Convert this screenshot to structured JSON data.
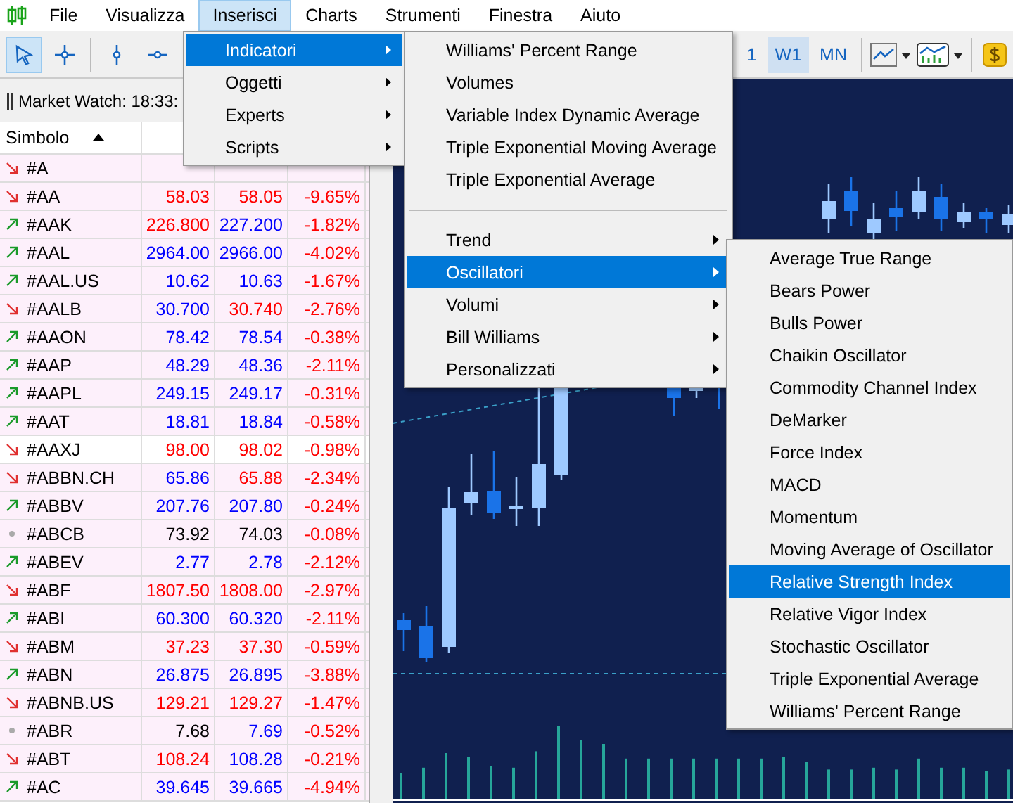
{
  "menubar": [
    {
      "label": "File",
      "selected": false
    },
    {
      "label": "Visualizza",
      "selected": false
    },
    {
      "label": "Inserisci",
      "selected": true
    },
    {
      "label": "Charts",
      "selected": false
    },
    {
      "label": "Strumenti",
      "selected": false
    },
    {
      "label": "Finestra",
      "selected": false
    },
    {
      "label": "Aiuto",
      "selected": false
    }
  ],
  "toolbar": {
    "timeframes": [
      {
        "label": "1",
        "selected": false
      },
      {
        "label": "W1",
        "selected": true
      },
      {
        "label": "MN",
        "selected": false
      }
    ]
  },
  "market_watch": {
    "title": "Market Watch: 18:33:",
    "columns": [
      "Simbolo"
    ],
    "rows": [
      {
        "symbol": "#A",
        "kind": "down",
        "shaded": true
      },
      {
        "symbol": "#AA",
        "kind": "down",
        "bid": {
          "text": "58.03",
          "color": "#ff0000"
        },
        "ask": {
          "text": "58.05",
          "color": "#ff0000"
        },
        "change": "-9.65%",
        "shaded": true
      },
      {
        "symbol": "#AAK",
        "kind": "up",
        "bid": {
          "text": "226.800",
          "color": "#ff0000"
        },
        "ask": {
          "text": "227.200",
          "color": "#0000ff"
        },
        "change": "-1.82%",
        "shaded": true
      },
      {
        "symbol": "#AAL",
        "kind": "up",
        "bid": {
          "text": "2964.00",
          "color": "#0000ff"
        },
        "ask": {
          "text": "2966.00",
          "color": "#0000ff"
        },
        "change": "-4.02%",
        "shaded": true
      },
      {
        "symbol": "#AAL.US",
        "kind": "up",
        "bid": {
          "text": "10.62",
          "color": "#0000ff"
        },
        "ask": {
          "text": "10.63",
          "color": "#0000ff"
        },
        "change": "-1.67%",
        "shaded": true
      },
      {
        "symbol": "#AALB",
        "kind": "down",
        "bid": {
          "text": "30.700",
          "color": "#0000ff"
        },
        "ask": {
          "text": "30.740",
          "color": "#ff0000"
        },
        "change": "-2.76%",
        "shaded": true
      },
      {
        "symbol": "#AAON",
        "kind": "up",
        "bid": {
          "text": "78.42",
          "color": "#0000ff"
        },
        "ask": {
          "text": "78.54",
          "color": "#0000ff"
        },
        "change": "-0.38%",
        "shaded": true
      },
      {
        "symbol": "#AAP",
        "kind": "up",
        "bid": {
          "text": "48.29",
          "color": "#0000ff"
        },
        "ask": {
          "text": "48.36",
          "color": "#0000ff"
        },
        "change": "-2.11%",
        "shaded": true
      },
      {
        "symbol": "#AAPL",
        "kind": "up",
        "bid": {
          "text": "249.15",
          "color": "#0000ff"
        },
        "ask": {
          "text": "249.17",
          "color": "#0000ff"
        },
        "change": "-0.31%",
        "shaded": true
      },
      {
        "symbol": "#AAT",
        "kind": "up",
        "bid": {
          "text": "18.81",
          "color": "#0000ff"
        },
        "ask": {
          "text": "18.84",
          "color": "#0000ff"
        },
        "change": "-0.58%",
        "shaded": true
      },
      {
        "symbol": "#AAXJ",
        "kind": "down",
        "bid": {
          "text": "98.00",
          "color": "#ff0000"
        },
        "ask": {
          "text": "98.02",
          "color": "#ff0000"
        },
        "change": "-0.98%",
        "shaded": false
      },
      {
        "symbol": "#ABBN.CH",
        "kind": "down",
        "bid": {
          "text": "65.86",
          "color": "#0000ff"
        },
        "ask": {
          "text": "65.88",
          "color": "#ff0000"
        },
        "change": "-2.34%",
        "shaded": true
      },
      {
        "symbol": "#ABBV",
        "kind": "up",
        "bid": {
          "text": "207.76",
          "color": "#0000ff"
        },
        "ask": {
          "text": "207.80",
          "color": "#0000ff"
        },
        "change": "-0.24%",
        "shaded": true
      },
      {
        "symbol": "#ABCB",
        "kind": "flat",
        "bid": {
          "text": "73.92",
          "color": "#000000"
        },
        "ask": {
          "text": "74.03",
          "color": "#000000"
        },
        "change": "-0.08%",
        "shaded": true
      },
      {
        "symbol": "#ABEV",
        "kind": "up",
        "bid": {
          "text": "2.77",
          "color": "#0000ff"
        },
        "ask": {
          "text": "2.78",
          "color": "#0000ff"
        },
        "change": "-2.12%",
        "shaded": true
      },
      {
        "symbol": "#ABF",
        "kind": "down",
        "bid": {
          "text": "1807.50",
          "color": "#ff0000"
        },
        "ask": {
          "text": "1808.00",
          "color": "#ff0000"
        },
        "change": "-2.97%",
        "shaded": true
      },
      {
        "symbol": "#ABI",
        "kind": "up",
        "bid": {
          "text": "60.300",
          "color": "#0000ff"
        },
        "ask": {
          "text": "60.320",
          "color": "#0000ff"
        },
        "change": "-2.11%",
        "shaded": true
      },
      {
        "symbol": "#ABM",
        "kind": "down",
        "bid": {
          "text": "37.23",
          "color": "#ff0000"
        },
        "ask": {
          "text": "37.30",
          "color": "#ff0000"
        },
        "change": "-0.59%",
        "shaded": true
      },
      {
        "symbol": "#ABN",
        "kind": "up",
        "bid": {
          "text": "26.875",
          "color": "#0000ff"
        },
        "ask": {
          "text": "26.895",
          "color": "#0000ff"
        },
        "change": "-3.88%",
        "shaded": true
      },
      {
        "symbol": "#ABNB.US",
        "kind": "down",
        "bid": {
          "text": "129.21",
          "color": "#ff0000"
        },
        "ask": {
          "text": "129.27",
          "color": "#ff0000"
        },
        "change": "-1.47%",
        "shaded": true
      },
      {
        "symbol": "#ABR",
        "kind": "flat",
        "bid": {
          "text": "7.68",
          "color": "#000000"
        },
        "ask": {
          "text": "7.69",
          "color": "#0000ff"
        },
        "change": "-0.52%",
        "shaded": true
      },
      {
        "symbol": "#ABT",
        "kind": "down",
        "bid": {
          "text": "108.24",
          "color": "#ff0000"
        },
        "ask": {
          "text": "108.28",
          "color": "#0000ff"
        },
        "change": "-0.21%",
        "shaded": true
      },
      {
        "symbol": "#AC",
        "kind": "up",
        "bid": {
          "text": "39.645",
          "color": "#0000ff"
        },
        "ask": {
          "text": "39.665",
          "color": "#0000ff"
        },
        "change": "-4.94%",
        "shaded": true
      }
    ]
  },
  "insert_menu": [
    {
      "label": "Indicatori",
      "selected": true
    },
    {
      "label": "Oggetti",
      "selected": false
    },
    {
      "label": "Experts",
      "selected": false
    },
    {
      "label": "Scripts",
      "selected": false
    }
  ],
  "indicators_menu": [
    {
      "kind": "item",
      "label": "Williams' Percent Range",
      "selected": false
    },
    {
      "kind": "item",
      "label": "Volumes",
      "selected": false
    },
    {
      "kind": "item",
      "label": "Variable Index Dynamic Average",
      "selected": false
    },
    {
      "kind": "item",
      "label": "Triple Exponential Moving Average",
      "selected": false
    },
    {
      "kind": "item",
      "label": "Triple Exponential Average",
      "selected": false
    },
    {
      "kind": "separator"
    },
    {
      "kind": "submenu",
      "label": "Trend",
      "selected": false
    },
    {
      "kind": "submenu",
      "label": "Oscillatori",
      "selected": true
    },
    {
      "kind": "submenu",
      "label": "Volumi",
      "selected": false
    },
    {
      "kind": "submenu",
      "label": "Bill Williams",
      "selected": false
    },
    {
      "kind": "submenu",
      "label": "Personalizzati",
      "selected": false
    }
  ],
  "oscillators_menu": [
    {
      "label": "Average True Range",
      "selected": false
    },
    {
      "label": "Bears Power",
      "selected": false
    },
    {
      "label": "Bulls Power",
      "selected": false
    },
    {
      "label": "Chaikin Oscillator",
      "selected": false
    },
    {
      "label": "Commodity Channel Index",
      "selected": false
    },
    {
      "label": "DeMarker",
      "selected": false
    },
    {
      "label": "Force Index",
      "selected": false
    },
    {
      "label": "MACD",
      "selected": false
    },
    {
      "label": "Momentum",
      "selected": false
    },
    {
      "label": "Moving Average of Oscillator",
      "selected": false
    },
    {
      "label": "Relative Strength Index",
      "selected": true
    },
    {
      "label": "Relative Vigor Index",
      "selected": false
    },
    {
      "label": "Stochastic Oscillator",
      "selected": false
    },
    {
      "label": "Triple Exponential Average",
      "selected": false
    },
    {
      "label": "Williams' Percent Range",
      "selected": false
    }
  ]
}
